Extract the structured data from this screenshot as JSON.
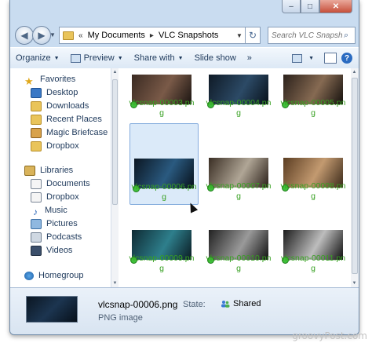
{
  "window": {
    "caption": {
      "minimize": "–",
      "maximize": "□",
      "close": "✕"
    }
  },
  "address": {
    "back_icon": "back-arrow-icon",
    "forward_icon": "forward-arrow-icon",
    "crumbs": [
      "My Documents",
      "VLC Snapshots"
    ],
    "separator": "▸",
    "lead": "«",
    "refresh": "↻",
    "search_placeholder": "Search VLC Snapshots"
  },
  "toolbar": {
    "organize": "Organize",
    "preview": "Preview",
    "share_with": "Share with",
    "slide_show": "Slide show",
    "more": "»",
    "help": "?"
  },
  "nav": {
    "favorites": {
      "label": "Favorites",
      "items": [
        "Desktop",
        "Downloads",
        "Recent Places",
        "Magic Briefcase",
        "Dropbox"
      ]
    },
    "libraries": {
      "label": "Libraries",
      "items": [
        "Documents",
        "Dropbox",
        "Music",
        "Pictures",
        "Podcasts",
        "Videos"
      ]
    },
    "homegroup": "Homegroup"
  },
  "files": [
    {
      "name": "vlcsnap-00003.pn",
      "tail": "g",
      "colors": [
        "#3a2a22",
        "#7a5a48",
        "#1a1411"
      ]
    },
    {
      "name": "vlcsnap-00004.pn",
      "tail": "g",
      "colors": [
        "#0f1a26",
        "#2c4a66",
        "#08111a"
      ]
    },
    {
      "name": "vlcsnap-00005.pn",
      "tail": "g",
      "colors": [
        "#2b211b",
        "#866a52",
        "#14100d"
      ]
    },
    {
      "name": "vlcsnap-00006.pn",
      "tail": "g",
      "colors": [
        "#0b1622",
        "#2a5a80",
        "#07101a"
      ]
    },
    {
      "name": "vlcsnap-00007.pn",
      "tail": "g",
      "colors": [
        "#3a2e24",
        "#b0a696",
        "#2a1f18"
      ]
    },
    {
      "name": "vlcsnap-00008.pn",
      "tail": "g",
      "colors": [
        "#5b3d22",
        "#c39a70",
        "#3b2a1a"
      ]
    },
    {
      "name": "vlcsnap-00009.pn",
      "tail": "g",
      "colors": [
        "#0e2a33",
        "#2e7f8c",
        "#0a1b22"
      ]
    },
    {
      "name": "vlcsnap-00010.pn",
      "tail": "g",
      "colors": [
        "#222222",
        "#9a9a9a",
        "#111111"
      ]
    },
    {
      "name": "vlcsnap-00011.pn",
      "tail": "g",
      "colors": [
        "#1c1c1c",
        "#bdbdbd",
        "#0e0e0e"
      ]
    }
  ],
  "details": {
    "name": "vlcsnap-00006.png",
    "type": "PNG image",
    "state_label": "State:",
    "state_value": "Shared"
  },
  "watermark": "groovyPost.com"
}
